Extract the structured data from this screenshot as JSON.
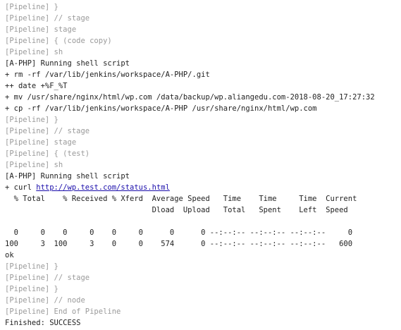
{
  "console": {
    "lines": [
      {
        "kind": "meta",
        "text": "[Pipeline] }"
      },
      {
        "kind": "meta",
        "text": "[Pipeline] // stage"
      },
      {
        "kind": "meta",
        "text": "[Pipeline] stage"
      },
      {
        "kind": "meta",
        "text": "[Pipeline] { (code copy)"
      },
      {
        "kind": "meta",
        "text": "[Pipeline] sh"
      },
      {
        "kind": "plain",
        "text": "[A-PHP] Running shell script"
      },
      {
        "kind": "plain",
        "text": "+ rm -rf /var/lib/jenkins/workspace/A-PHP/.git"
      },
      {
        "kind": "plain",
        "text": "++ date +%F_%T"
      },
      {
        "kind": "plain",
        "text": "+ mv /usr/share/nginx/html/wp.com /data/backup/wp.aliangedu.com-2018-08-20_17:27:32"
      },
      {
        "kind": "plain",
        "text": "+ cp -rf /var/lib/jenkins/workspace/A-PHP /usr/share/nginx/html/wp.com"
      },
      {
        "kind": "meta",
        "text": "[Pipeline] }"
      },
      {
        "kind": "meta",
        "text": "[Pipeline] // stage"
      },
      {
        "kind": "meta",
        "text": "[Pipeline] stage"
      },
      {
        "kind": "meta",
        "text": "[Pipeline] { (test)"
      },
      {
        "kind": "meta",
        "text": "[Pipeline] sh"
      },
      {
        "kind": "plain",
        "text": "[A-PHP] Running shell script"
      },
      {
        "kind": "link",
        "prefix": "+ curl ",
        "link": "http://wp.test.com/status.html"
      },
      {
        "kind": "plain",
        "text": "  % Total    % Received % Xferd  Average Speed   Time    Time     Time  Current"
      },
      {
        "kind": "plain",
        "text": "                                 Dload  Upload   Total   Spent    Left  Speed"
      },
      {
        "kind": "plain",
        "text": ""
      },
      {
        "kind": "plain",
        "text": "  0     0    0     0    0     0      0      0 --:--:-- --:--:-- --:--:--     0"
      },
      {
        "kind": "plain",
        "text": "100     3  100     3    0     0    574      0 --:--:-- --:--:-- --:--:--   600"
      },
      {
        "kind": "plain",
        "text": "ok"
      },
      {
        "kind": "meta",
        "text": "[Pipeline] }"
      },
      {
        "kind": "meta",
        "text": "[Pipeline] // stage"
      },
      {
        "kind": "meta",
        "text": "[Pipeline] }"
      },
      {
        "kind": "meta",
        "text": "[Pipeline] // node"
      },
      {
        "kind": "meta",
        "text": "[Pipeline] End of Pipeline"
      },
      {
        "kind": "plain",
        "text": "Finished: SUCCESS"
      }
    ]
  }
}
